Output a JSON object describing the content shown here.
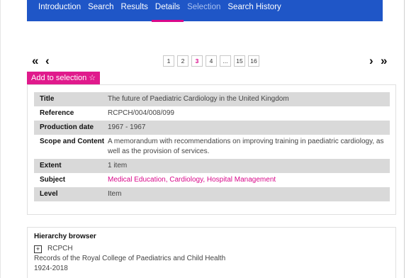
{
  "nav": {
    "tabs": [
      {
        "label": "Introduction"
      },
      {
        "label": "Search"
      },
      {
        "label": "Results"
      },
      {
        "label": "Details"
      },
      {
        "label": "Selection"
      },
      {
        "label": "Search History"
      }
    ],
    "active": "Details"
  },
  "pager": {
    "first": "«",
    "prev": "‹",
    "next": "›",
    "last": "»",
    "pages": [
      "1",
      "2",
      "3",
      "4",
      "...",
      "15",
      "16"
    ],
    "current": "3"
  },
  "actions": {
    "add_label": "Add to selection",
    "star": "☆"
  },
  "record": {
    "rows": [
      {
        "key": "Title",
        "value": "The future of Paediatric Cardiology in the United Kingdom"
      },
      {
        "key": "Reference",
        "value": "RCPCH/004/008/099"
      },
      {
        "key": "Production date",
        "value": "1967 - 1967"
      },
      {
        "key": "Scope and Content",
        "value": "A memorandum with recommendations on improving training in paediatric cardiology, as well as the provision of services."
      },
      {
        "key": "Extent",
        "value": "1 item"
      },
      {
        "key": "Subject",
        "value": "Medical Education, Cardiology, Hospital Management"
      },
      {
        "key": "Level",
        "value": "Item"
      }
    ]
  },
  "hierarchy": {
    "title": "Hierarchy browser",
    "toggle": "+",
    "code": "RCPCH",
    "name": "Records of the Royal College of Paediatrics and Child Health",
    "dates": "1924-2018"
  },
  "colors": {
    "nav_bg": "#1f56c7",
    "accent": "#d9088a",
    "button_bg": "#e01a8c",
    "row_shade": "#d9d9d9"
  }
}
